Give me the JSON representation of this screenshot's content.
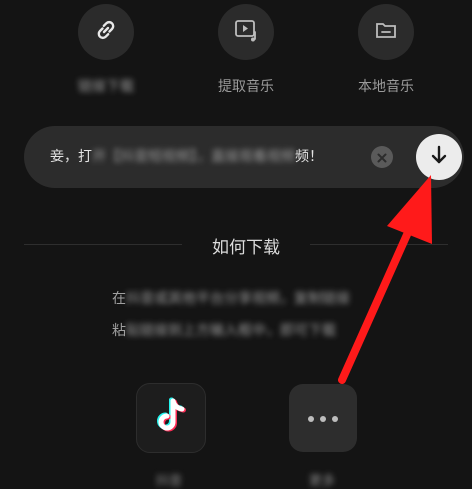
{
  "top_actions": [
    {
      "id": "link",
      "label": "链接下载",
      "icon": "link-icon"
    },
    {
      "id": "extract",
      "label": "提取音乐",
      "icon": "video-music-icon"
    },
    {
      "id": "local",
      "label": "本地音乐",
      "icon": "folder-icon"
    }
  ],
  "input": {
    "visible_prefix": "妾，打",
    "obscured_text": "开【抖音短视频】，直接观看视频",
    "visible_suffix": "频！"
  },
  "section": {
    "title": "如何下载"
  },
  "help": {
    "line1_prefix": "在",
    "line1_obscured": "抖音或其他平台分享视频，复制链接",
    "line2_prefix": "粘",
    "line2_obscured": "贴链接到上方输入框中，即可下载"
  },
  "apps": [
    {
      "id": "douyin",
      "label": "抖音",
      "icon": "tiktok-icon"
    },
    {
      "id": "more",
      "label": "更多",
      "icon": "more-dots-icon"
    }
  ],
  "colors": {
    "background": "#141414",
    "annotation_arrow": "#ff1a1a"
  }
}
